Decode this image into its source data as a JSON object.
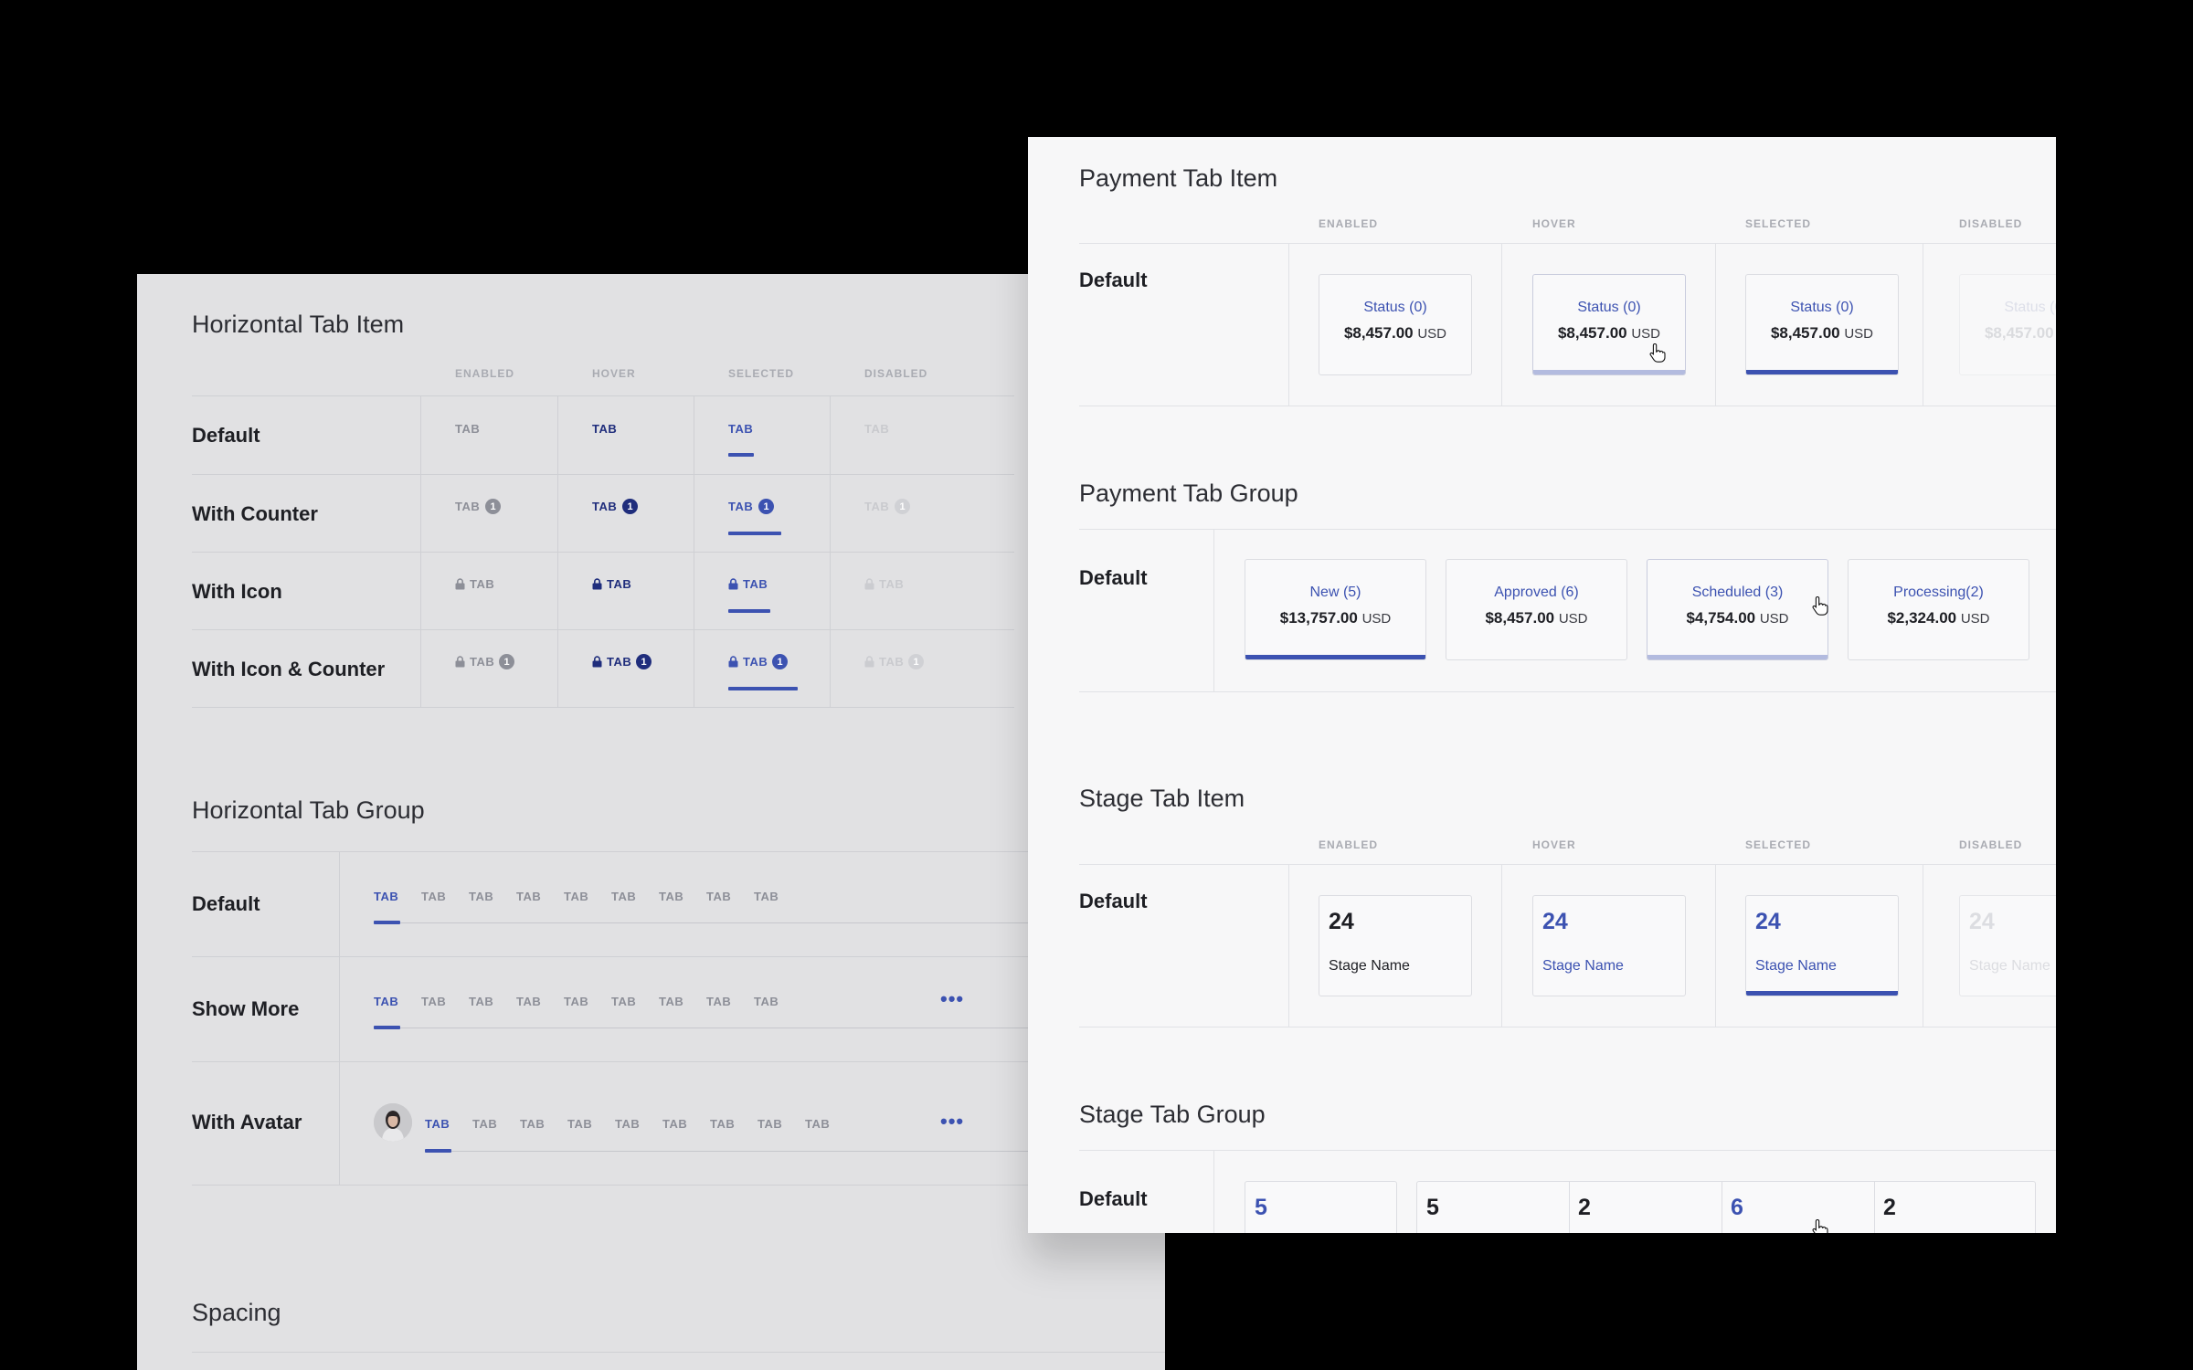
{
  "left": {
    "hti": {
      "title": "Horizontal Tab Item",
      "cols": [
        "ENABLED",
        "HOVER",
        "SELECTED",
        "DISABLED"
      ],
      "rows": [
        "Default",
        "With Counter",
        "With Icon",
        "With Icon & Counter"
      ],
      "tab_label": "TAB",
      "counter": "1"
    },
    "htg": {
      "title": "Horizontal Tab Group",
      "rows": [
        "Default",
        "Show More",
        "With Avatar"
      ],
      "tab_label": "TAB",
      "more": "•••"
    },
    "spacing": {
      "title": "Spacing"
    }
  },
  "right": {
    "pti": {
      "title": "Payment Tab Item",
      "cols": [
        "ENABLED",
        "HOVER",
        "SELECTED",
        "DISABLED"
      ],
      "row": "Default",
      "card_title": "Status (0)",
      "card_amount": "$8,457.00",
      "currency": "USD"
    },
    "ptg": {
      "title": "Payment Tab Group",
      "row": "Default",
      "cards": [
        {
          "title": "New (5)",
          "amount": "$13,757.00"
        },
        {
          "title": "Approved (6)",
          "amount": "$8,457.00"
        },
        {
          "title": "Scheduled (3)",
          "amount": "$4,754.00"
        },
        {
          "title": "Processing(2)",
          "amount": "$2,324.00"
        }
      ],
      "currency": "USD"
    },
    "sti": {
      "title": "Stage Tab Item",
      "cols": [
        "ENABLED",
        "HOVER",
        "SELECTED",
        "DISABLED"
      ],
      "row": "Default",
      "count": "24",
      "name": "Stage Name"
    },
    "stg": {
      "title": "Stage Tab Group",
      "row": "Default",
      "counts": [
        "5",
        "5",
        "2",
        "6",
        "2"
      ]
    }
  },
  "colors": {
    "primary": "#3c52b1",
    "dark": "#1f2d7c",
    "muted": "#8d8f98",
    "disabled": "#c9cace"
  }
}
